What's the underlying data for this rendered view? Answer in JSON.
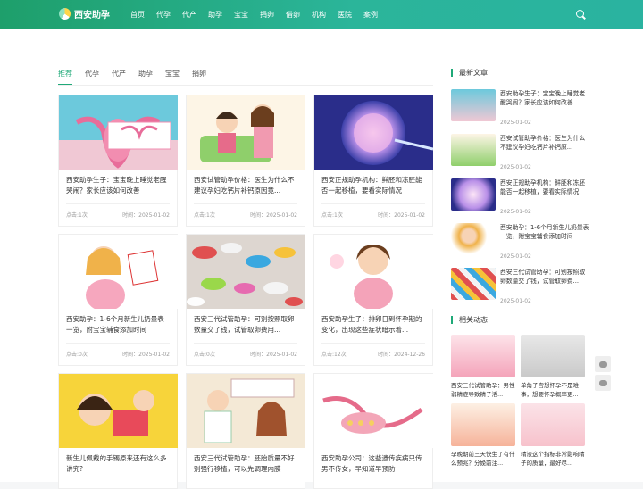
{
  "site": {
    "logo_text": "西安助孕"
  },
  "nav": [
    "首页",
    "代孕",
    "代产",
    "助孕",
    "宝宝",
    "捐卵",
    "借卵",
    "机构",
    "医院",
    "案例"
  ],
  "tabs": [
    "推荐",
    "代孕",
    "代产",
    "助孕",
    "宝宝",
    "捐卵"
  ],
  "cards": [
    {
      "title": "西安助孕生子：宝宝晚上睡觉老醒哭闹？家长应该如何改善",
      "clicks": "点击:1次",
      "time": "时间：2025-01-02",
      "image": "uterus-illustration"
    },
    {
      "title": "西安试管助孕价格：医生为什么不建议孕妇吃钙片补钙原因竟...",
      "clicks": "点击:1次",
      "time": "时间：2025-01-02",
      "image": "family-cartoon"
    },
    {
      "title": "西安正规助孕机构：鲜胚和冻胚能否一起移植，要看实际情况",
      "clicks": "点击:1次",
      "time": "时间：2025-01-02",
      "image": "egg-cell"
    },
    {
      "title": "西安助孕：1-6个月新生儿奶量表一览，附宝宝辅食添加时间",
      "clicks": "点击:0次",
      "time": "时间：2025-01-02",
      "image": "pregnant-cartoon"
    },
    {
      "title": "西安三代试管助孕：可别按照取卵数量交了钱，试管取卵费用...",
      "clicks": "点击:0次",
      "time": "时间：2025-01-02",
      "image": "pills"
    },
    {
      "title": "西安助孕生子：排卵日到怀孕期的变化，出现这些症状暗示着...",
      "clicks": "点击:12次",
      "time": "时间：2024-12-26",
      "image": "girl-cartoon"
    },
    {
      "title": "新生儿佩戴的手镯原来还有这么多讲究?",
      "clicks": "",
      "time": "",
      "image": "baby-family"
    },
    {
      "title": "西安三代试管助孕：胚胎质量不好别强行移植，可以先调理内膜",
      "clicks": "",
      "time": "",
      "image": "doctor-cartoon"
    },
    {
      "title": "西安助孕公司：这些遗传疾病只传男不传女，早知道早预防",
      "clicks": "",
      "time": "",
      "image": "ovary"
    }
  ],
  "sidebar": {
    "latest_title": "最新文章",
    "latest": [
      {
        "title": "西安助孕生子：宝宝晚上睡觉老醒哭闹？家长应该如何改善",
        "date": "2025-01-02"
      },
      {
        "title": "西安试管助孕价格：医生为什么不建议孕妇吃钙片补钙原...",
        "date": "2025-01-02"
      },
      {
        "title": "西安正规助孕机构：鲜胚和冻胚能否一起移植，要看实际情况",
        "date": "2025-01-02"
      },
      {
        "title": "西安助孕：1-6个月新生儿奶量表一览，附宝宝辅食添加时间",
        "date": "2025-01-02"
      },
      {
        "title": "西安三代试管助孕：可别按照取卵数量交了钱，试管取卵费...",
        "date": "2025-01-02"
      }
    ],
    "dynamic_title": "相关动态",
    "dynamic": [
      {
        "title": "西安三代试管助孕：男性弱精症导致精子活..."
      },
      {
        "title": "单角子宫想怀孕不是难事，想要怀孕概率更..."
      },
      {
        "title": "孕晚期前三天快生了有什么预兆？分娩前注..."
      },
      {
        "title": "精液这个指标非常影响精子的质量，最好尽..."
      }
    ]
  }
}
